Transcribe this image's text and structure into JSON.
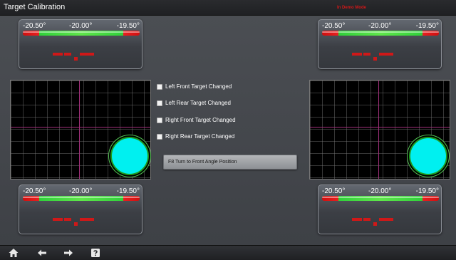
{
  "window": {
    "title": "Target Calibration",
    "mode_label": "In Demo Mode"
  },
  "gauges": [
    {
      "left": "-20.50°",
      "center": "-20.00°",
      "right": "-19.50°"
    },
    {
      "left": "-20.50°",
      "center": "-20.00°",
      "right": "-19.50°"
    },
    {
      "left": "-20.50°",
      "center": "-20.00°",
      "right": "-19.50°"
    },
    {
      "left": "-20.50°",
      "center": "-20.00°",
      "right": "-19.50°"
    }
  ],
  "options": [
    {
      "label": "Left Front Target Changed",
      "checked": false
    },
    {
      "label": "Left Rear Target Changed",
      "checked": false
    },
    {
      "label": "Right Front Target Changed",
      "checked": false
    },
    {
      "label": "Right Rear Target Changed",
      "checked": false
    }
  ],
  "action": {
    "label": "F8  Turn to Front Angle Position"
  },
  "nav": {
    "icons": [
      "home-icon",
      "arrow-left-icon",
      "arrow-right-icon",
      "help-icon"
    ]
  },
  "colors": {
    "target": "#00f0f0",
    "in_range": "#2fd03a",
    "out_of_range": "#e82020",
    "demo_text": "#d01818"
  }
}
